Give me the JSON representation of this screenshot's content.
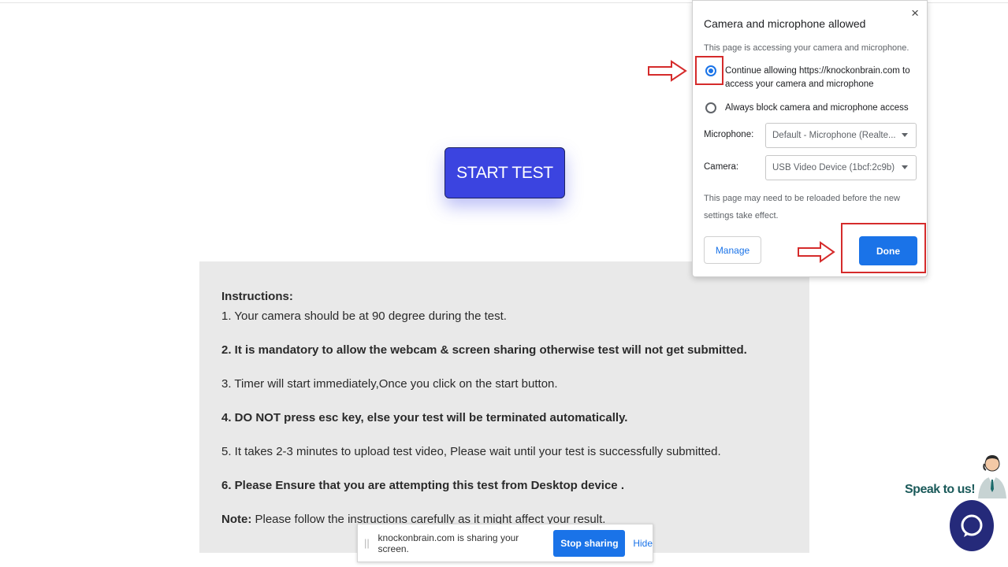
{
  "page": {
    "start_button_label": "START TEST"
  },
  "instructions": {
    "title": "Instructions:",
    "items": [
      "1. Your camera should be at 90 degree during the test.",
      "2. It is mandatory to allow the webcam & screen sharing otherwise test will not get submitted.",
      "3. Timer will start immediately,Once you click on the start button.",
      "4. DO NOT press esc key, else your test will be terminated automatically.",
      "5. It takes 2-3 minutes to upload test video, Please wait until your test is successfully submitted.",
      "6. Please Ensure that you are attempting this test from Desktop device ."
    ],
    "note_label": "Note:",
    "note_text": " Please follow the instructions carefully as it might affect your result."
  },
  "share_bar": {
    "message": "knockonbrain.com is sharing your screen.",
    "stop_label": "Stop sharing",
    "hide_label": "Hide"
  },
  "permission_popup": {
    "title": "Camera and microphone allowed",
    "subtitle": "This page is accessing your camera and microphone.",
    "option_allow": "Continue allowing https://knockonbrain.com to access your camera and microphone",
    "option_block": "Always block camera and microphone access",
    "selected_option": "allow",
    "microphone_label": "Microphone:",
    "microphone_value": "Default - Microphone (Realte...",
    "camera_label": "Camera:",
    "camera_value": "USB Video Device (1bcf:2c9b)",
    "reload_note": "This page may need to be reloaded before the new settings take effect.",
    "manage_label": "Manage",
    "done_label": "Done",
    "close_glyph": "×"
  },
  "chat_widget": {
    "label": "Speak to us!"
  },
  "colors": {
    "start_button": "#3b44e0",
    "accent_blue": "#1a73e8",
    "annotation_red": "#d52b2b",
    "chat_button": "#252a7a",
    "instructions_bg": "#e9e9e9"
  }
}
